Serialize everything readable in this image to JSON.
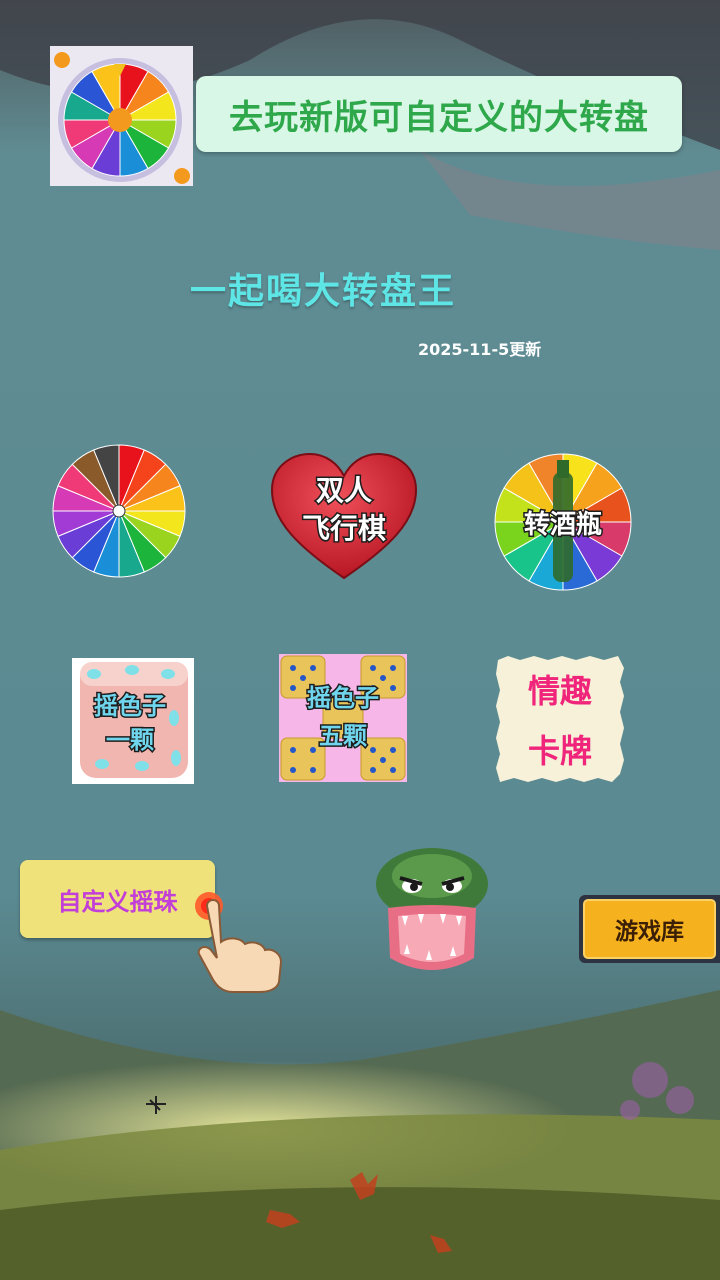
{
  "top_banner": {
    "thumbnail_icon": "wheel-thumbnail",
    "label": "去玩新版可自定义的大转盘"
  },
  "header": {
    "title": "一起喝大转盘王",
    "update_date": "2025-11-5更新"
  },
  "games": [
    {
      "icon": "color-wheel-icon",
      "label": ""
    },
    {
      "icon": "heart-icon",
      "label_line1": "双人",
      "label_line2": "飞行棋"
    },
    {
      "icon": "bottle-wheel-icon",
      "label": "转酒瓶"
    },
    {
      "icon": "single-dice-icon",
      "label_line1": "摇色子",
      "label_line2": "一颗"
    },
    {
      "icon": "five-dice-icon",
      "label_line1": "摇色子",
      "label_line2": "五颗"
    },
    {
      "icon": "card-icon",
      "label_line1": "情趣",
      "label_line2": "卡牌"
    }
  ],
  "custom_dice_button": {
    "label": "自定义摇珠",
    "icon": "pointing-hand-icon"
  },
  "crocodile_game": {
    "icon": "crocodile-icon"
  },
  "game_library_button": {
    "label": "游戏库"
  },
  "colors": {
    "background": "#5e8a90",
    "banner_bg": "#d9f7e6",
    "banner_text": "#2ea84a",
    "title": "#5ee6e6",
    "custom_btn_bg": "#f0e27a",
    "custom_btn_text": "#c23ed8",
    "library_btn": "#f6b21e"
  }
}
